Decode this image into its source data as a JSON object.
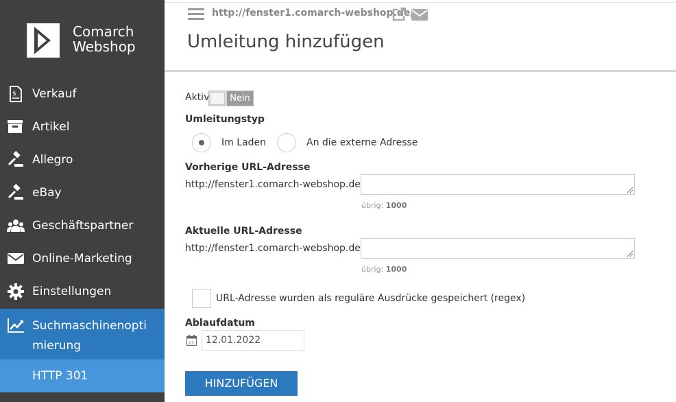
{
  "brand": {
    "line1": "Comarch",
    "line2": "Webshop"
  },
  "sidebar": {
    "items": [
      {
        "label": "Verkauf",
        "icon": "receipt-icon"
      },
      {
        "label": "Artikel",
        "icon": "archive-box-icon"
      },
      {
        "label": "Allegro",
        "icon": "gavel-icon"
      },
      {
        "label": "eBay",
        "icon": "gavel-icon"
      },
      {
        "label": "Geschäftspartner",
        "icon": "users-icon"
      },
      {
        "label": "Online-Marketing",
        "icon": "envelope-icon"
      },
      {
        "label": "Einstellungen",
        "icon": "gear-icon"
      },
      {
        "label": "Suchmaschinenoptimierung",
        "icon": "line-chart-icon",
        "active": true
      }
    ],
    "sub_item": "HTTP 301"
  },
  "header": {
    "url": "http://fenster1.comarch-webshop.de/",
    "title": "Umleitung hinzufügen"
  },
  "form": {
    "aktiv_label": "Aktiv",
    "aktiv_value": "Nein",
    "type_label": "Umleitungstyp",
    "type_options": [
      "Im Laden",
      "An die externe Adresse"
    ],
    "type_selected": "Im Laden",
    "prev_label": "Vorherige URL-Adresse",
    "prev_prefix": "http://fenster1.comarch-webshop.de/",
    "prev_value": "",
    "prev_remaining_label": "übrig:",
    "prev_remaining": "1000",
    "curr_label": "Aktuelle URL-Adresse",
    "curr_prefix": "http://fenster1.comarch-webshop.de/",
    "curr_value": "",
    "curr_remaining_label": "übrig:",
    "curr_remaining": "1000",
    "regex_label": "URL-Adresse wurden als reguläre Ausdrücke gespeichert (regex)",
    "regex_checked": false,
    "expiry_label": "Ablaufdatum",
    "expiry_value": "12.01.2022",
    "submit_label": "HINZUFÜGEN"
  },
  "colors": {
    "sidebar_bg": "#404040",
    "active_bg": "#2d79be",
    "sub_bg": "#4796dc",
    "button_bg": "#2d79be"
  }
}
